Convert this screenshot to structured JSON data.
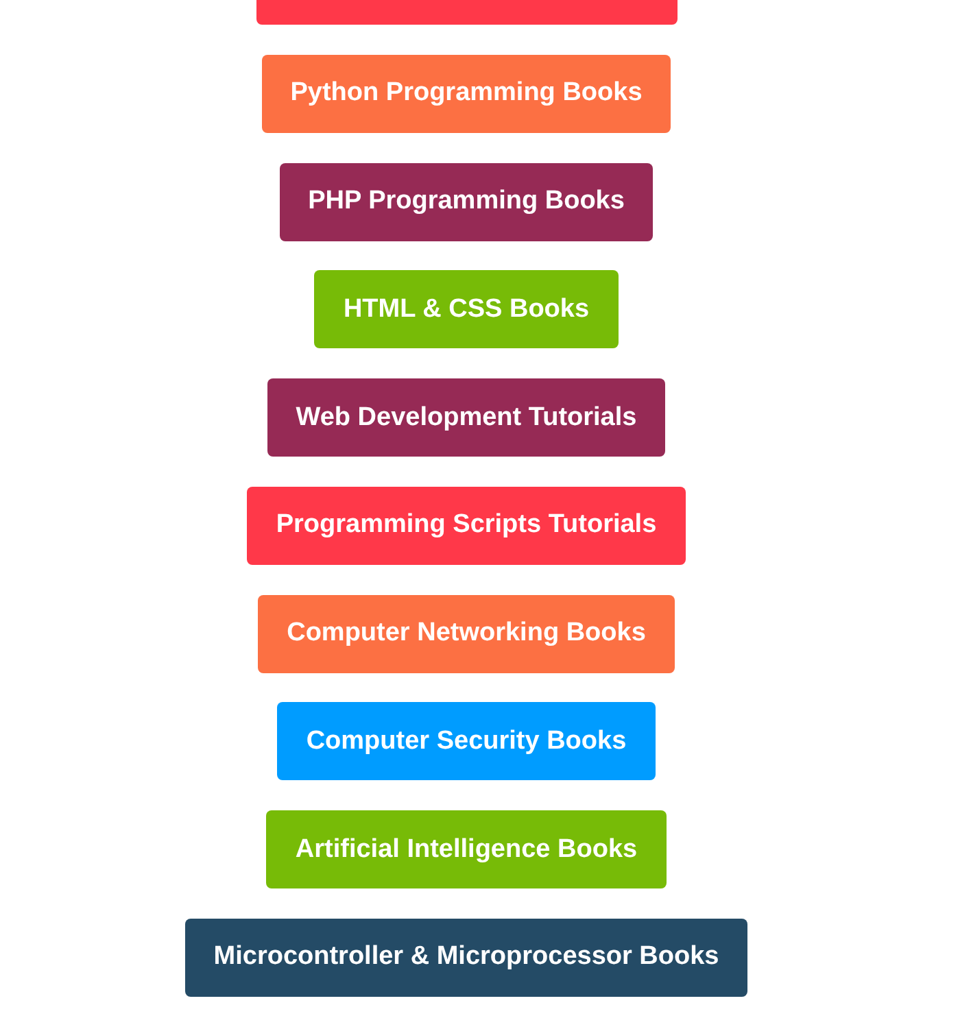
{
  "cut_button": {
    "color": "#ff3849"
  },
  "buttons": [
    {
      "label": "Python Programming Books",
      "color": "#fc7043"
    },
    {
      "label": "PHP Programming Books",
      "color": "#962a55"
    },
    {
      "label": "HTML & CSS Books",
      "color": "#77bb07"
    },
    {
      "label": "Web Development Tutorials",
      "color": "#962a55"
    },
    {
      "label": "Programming Scripts Tutorials",
      "color": "#ff3849"
    },
    {
      "label": "Computer Networking Books",
      "color": "#fc7043"
    },
    {
      "label": "Computer Security Books",
      "color": "#009cff"
    },
    {
      "label": "Artificial Intelligence Books",
      "color": "#77bb07"
    },
    {
      "label": "Microcontroller & Microprocessor Books",
      "color": "#244b66"
    }
  ]
}
